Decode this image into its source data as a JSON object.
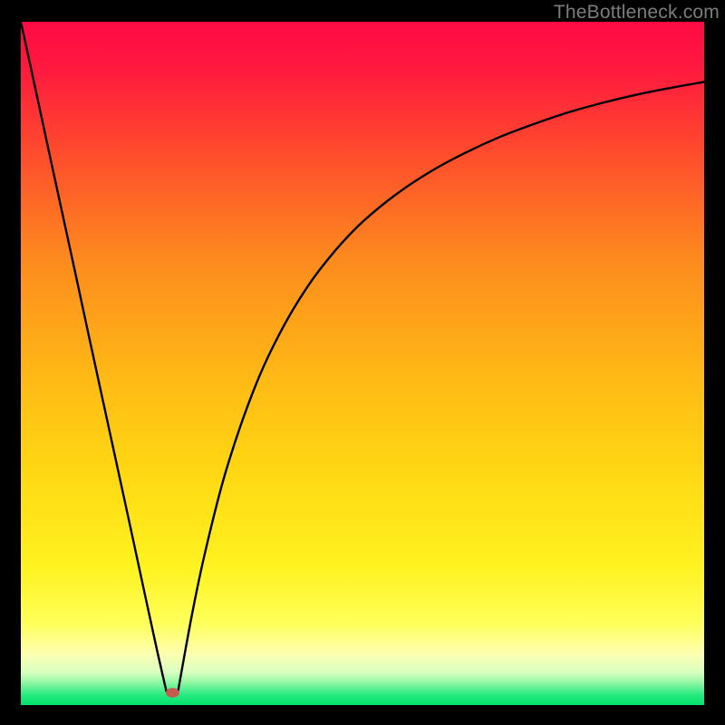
{
  "watermark": "TheBottleneck.com",
  "chart_data": {
    "type": "line",
    "title": "",
    "xlabel": "",
    "ylabel": "",
    "xlim": [
      0,
      1
    ],
    "ylim": [
      0,
      1
    ],
    "background_gradient": {
      "top": "#ff0a45",
      "mid_upper": "#fd8b1e",
      "mid": "#ffd813",
      "mid_lower": "#ffff3e",
      "low_band": "#fdffb0",
      "bottom": "#00e46b"
    },
    "series": [
      {
        "name": "left-branch",
        "type": "line",
        "x": [
          0.0,
          0.02,
          0.04,
          0.06,
          0.08,
          0.1,
          0.12,
          0.14,
          0.16,
          0.18,
          0.2,
          0.213
        ],
        "y": [
          1.0,
          0.908,
          0.815,
          0.723,
          0.631,
          0.538,
          0.446,
          0.354,
          0.262,
          0.169,
          0.077,
          0.02
        ]
      },
      {
        "name": "right-branch",
        "type": "line",
        "x": [
          0.23,
          0.25,
          0.27,
          0.3,
          0.34,
          0.38,
          0.42,
          0.46,
          0.5,
          0.55,
          0.6,
          0.65,
          0.7,
          0.75,
          0.8,
          0.85,
          0.9,
          0.95,
          1.0
        ],
        "y": [
          0.02,
          0.13,
          0.225,
          0.342,
          0.459,
          0.546,
          0.613,
          0.665,
          0.707,
          0.748,
          0.781,
          0.808,
          0.831,
          0.85,
          0.867,
          0.881,
          0.893,
          0.903,
          0.912
        ]
      }
    ],
    "marker": {
      "name": "min-point",
      "x": 0.222,
      "y": 0.018,
      "rx": 0.01,
      "ry": 0.007,
      "color": "#c65b4f"
    }
  }
}
